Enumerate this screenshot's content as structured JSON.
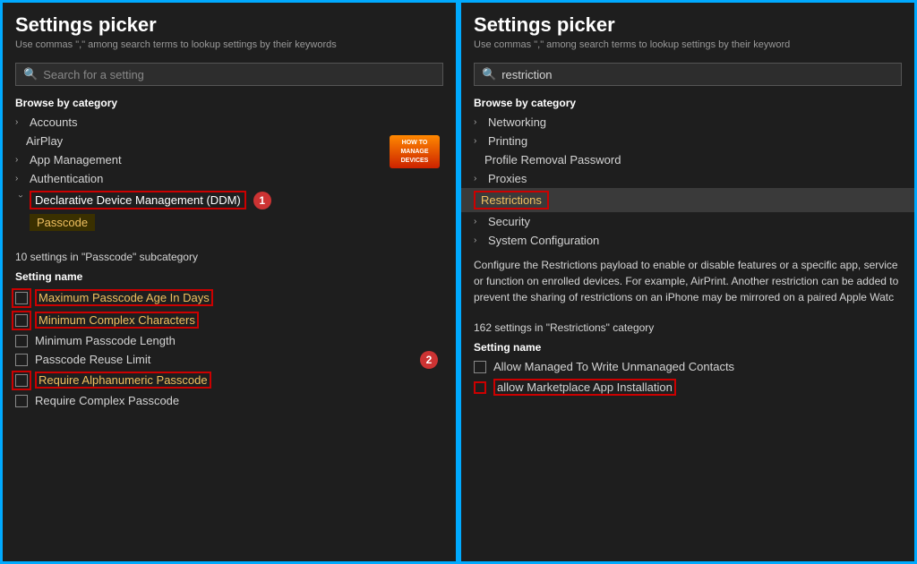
{
  "left": {
    "title": "Settings picker",
    "subtitle": "Use commas \",\" among search terms to lookup settings by their keywords",
    "search_placeholder": "Search for a setting",
    "browse_label": "Browse by category",
    "categories": [
      {
        "label": "Accounts",
        "expanded": false,
        "indent": 0
      },
      {
        "label": "AirPlay",
        "expanded": false,
        "indent": 1
      },
      {
        "label": "App Management",
        "expanded": false,
        "indent": 0
      },
      {
        "label": "Authentication",
        "expanded": false,
        "indent": 0
      },
      {
        "label": "Declarative Device Management (DDM)",
        "expanded": true,
        "indent": 0
      }
    ],
    "ddm_label": "Declarative Device Management (DDM)",
    "passcode_label": "Passcode",
    "badge_line1": "HOW TO",
    "badge_line2": "MANAGE",
    "badge_line3": "DEVICES",
    "settings_count_text": "10 settings in \"Passcode\" subcategory",
    "setting_name_header": "Setting name",
    "settings": [
      {
        "label": "Maximum Passcode Age In Days",
        "yellow": true,
        "red_border": true
      },
      {
        "label": "Minimum Complex Characters",
        "yellow": true,
        "red_border": true
      },
      {
        "label": "Minimum Passcode Length",
        "yellow": false,
        "red_border": false
      },
      {
        "label": "Passcode Reuse Limit",
        "yellow": false,
        "red_border": false
      },
      {
        "label": "Require Alphanumeric Passcode",
        "yellow": true,
        "red_border": true
      },
      {
        "label": "Require Complex Passcode",
        "yellow": false,
        "red_border": false
      }
    ],
    "badge_num": "1",
    "badge_num2": "2"
  },
  "right": {
    "title": "Settings picker",
    "subtitle": "Use commas \",\" among search terms to lookup settings by their keyword",
    "search_value": "restriction",
    "browse_label": "Browse by category",
    "categories": [
      {
        "label": "Networking",
        "expanded": false
      },
      {
        "label": "Printing",
        "expanded": false
      },
      {
        "label": "Profile Removal Password",
        "expanded": false,
        "plain": true
      },
      {
        "label": "Proxies",
        "expanded": false
      },
      {
        "label": "Restrictions",
        "expanded": false,
        "highlighted": true
      },
      {
        "label": "Security",
        "expanded": false
      },
      {
        "label": "System Configuration",
        "expanded": false
      }
    ],
    "description": "Configure the Restrictions payload to enable or disable features or a specific app, service or function on enrolled devices. For example, AirPrint. Another restriction can be added to prevent the sharing of restrictions on an iPhone may be mirrored on a paired Apple Watc",
    "settings_count_text": "162 settings in \"Restrictions\" category",
    "setting_name_header": "Setting name",
    "settings": [
      {
        "label": "Allow Managed To Write Unmanaged Contacts",
        "yellow": false,
        "red_border": false
      },
      {
        "label": "allow Marketplace App Installation",
        "yellow": false,
        "red_border": true
      }
    ]
  }
}
